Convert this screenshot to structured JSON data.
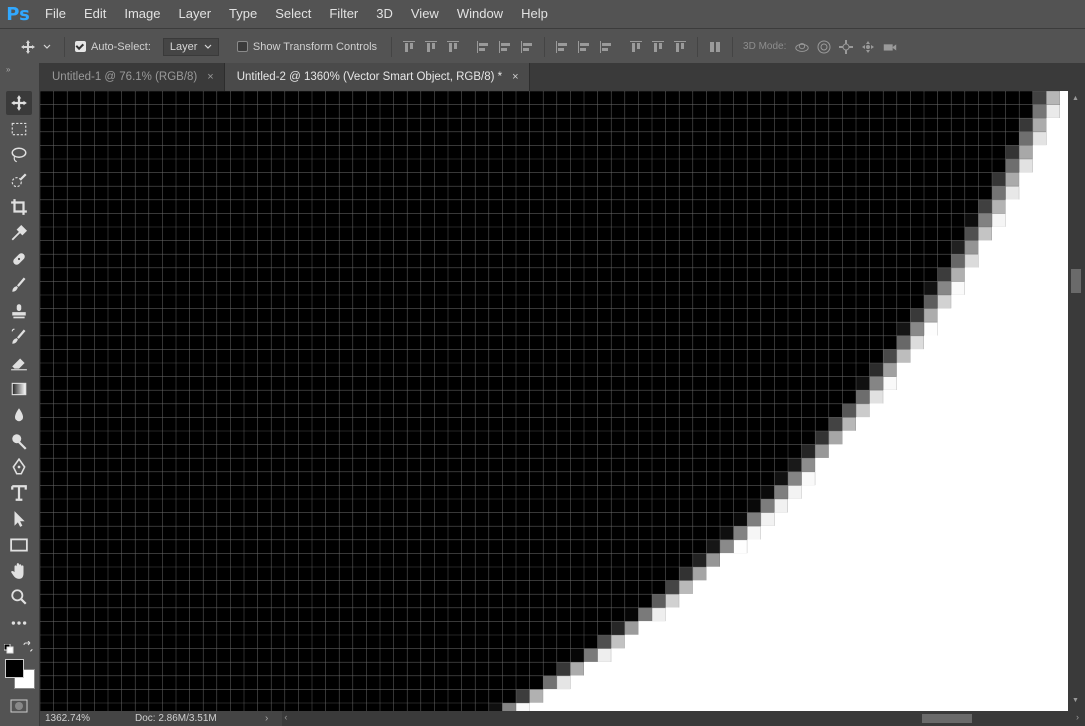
{
  "app": {
    "logo": "Ps"
  },
  "menu": [
    "File",
    "Edit",
    "Image",
    "Layer",
    "Type",
    "Select",
    "Filter",
    "3D",
    "View",
    "Window",
    "Help"
  ],
  "options": {
    "auto_select_label": "Auto-Select:",
    "auto_select_checked": true,
    "auto_select_target": "Layer",
    "show_transform_label": "Show Transform Controls",
    "show_transform_checked": false,
    "mode_3d_label": "3D Mode:"
  },
  "tabs": [
    {
      "title": "Untitled-1 @ 76.1% (RGB/8)",
      "close": "×",
      "active": false
    },
    {
      "title": "Untitled-2 @ 1360% (Vector Smart Object, RGB/8) *",
      "close": "×",
      "active": true
    }
  ],
  "status": {
    "zoom": "1362.74%",
    "doc": "Doc: 2.86M/3.51M"
  },
  "colors": {
    "foreground": "#000000",
    "background": "#ffffff",
    "accent": "#31a8ff"
  },
  "tools": [
    "move-icon",
    "marquee-icon",
    "lasso-icon",
    "quick-select-icon",
    "crop-icon",
    "eyedropper-icon",
    "healing-icon",
    "brush-icon",
    "stamp-icon",
    "history-brush-icon",
    "eraser-icon",
    "gradient-icon",
    "blur-icon",
    "dodge-icon",
    "pen-icon",
    "type-icon",
    "path-select-icon",
    "rectangle-icon",
    "hand-icon",
    "zoom-icon",
    "more-tools-icon"
  ]
}
